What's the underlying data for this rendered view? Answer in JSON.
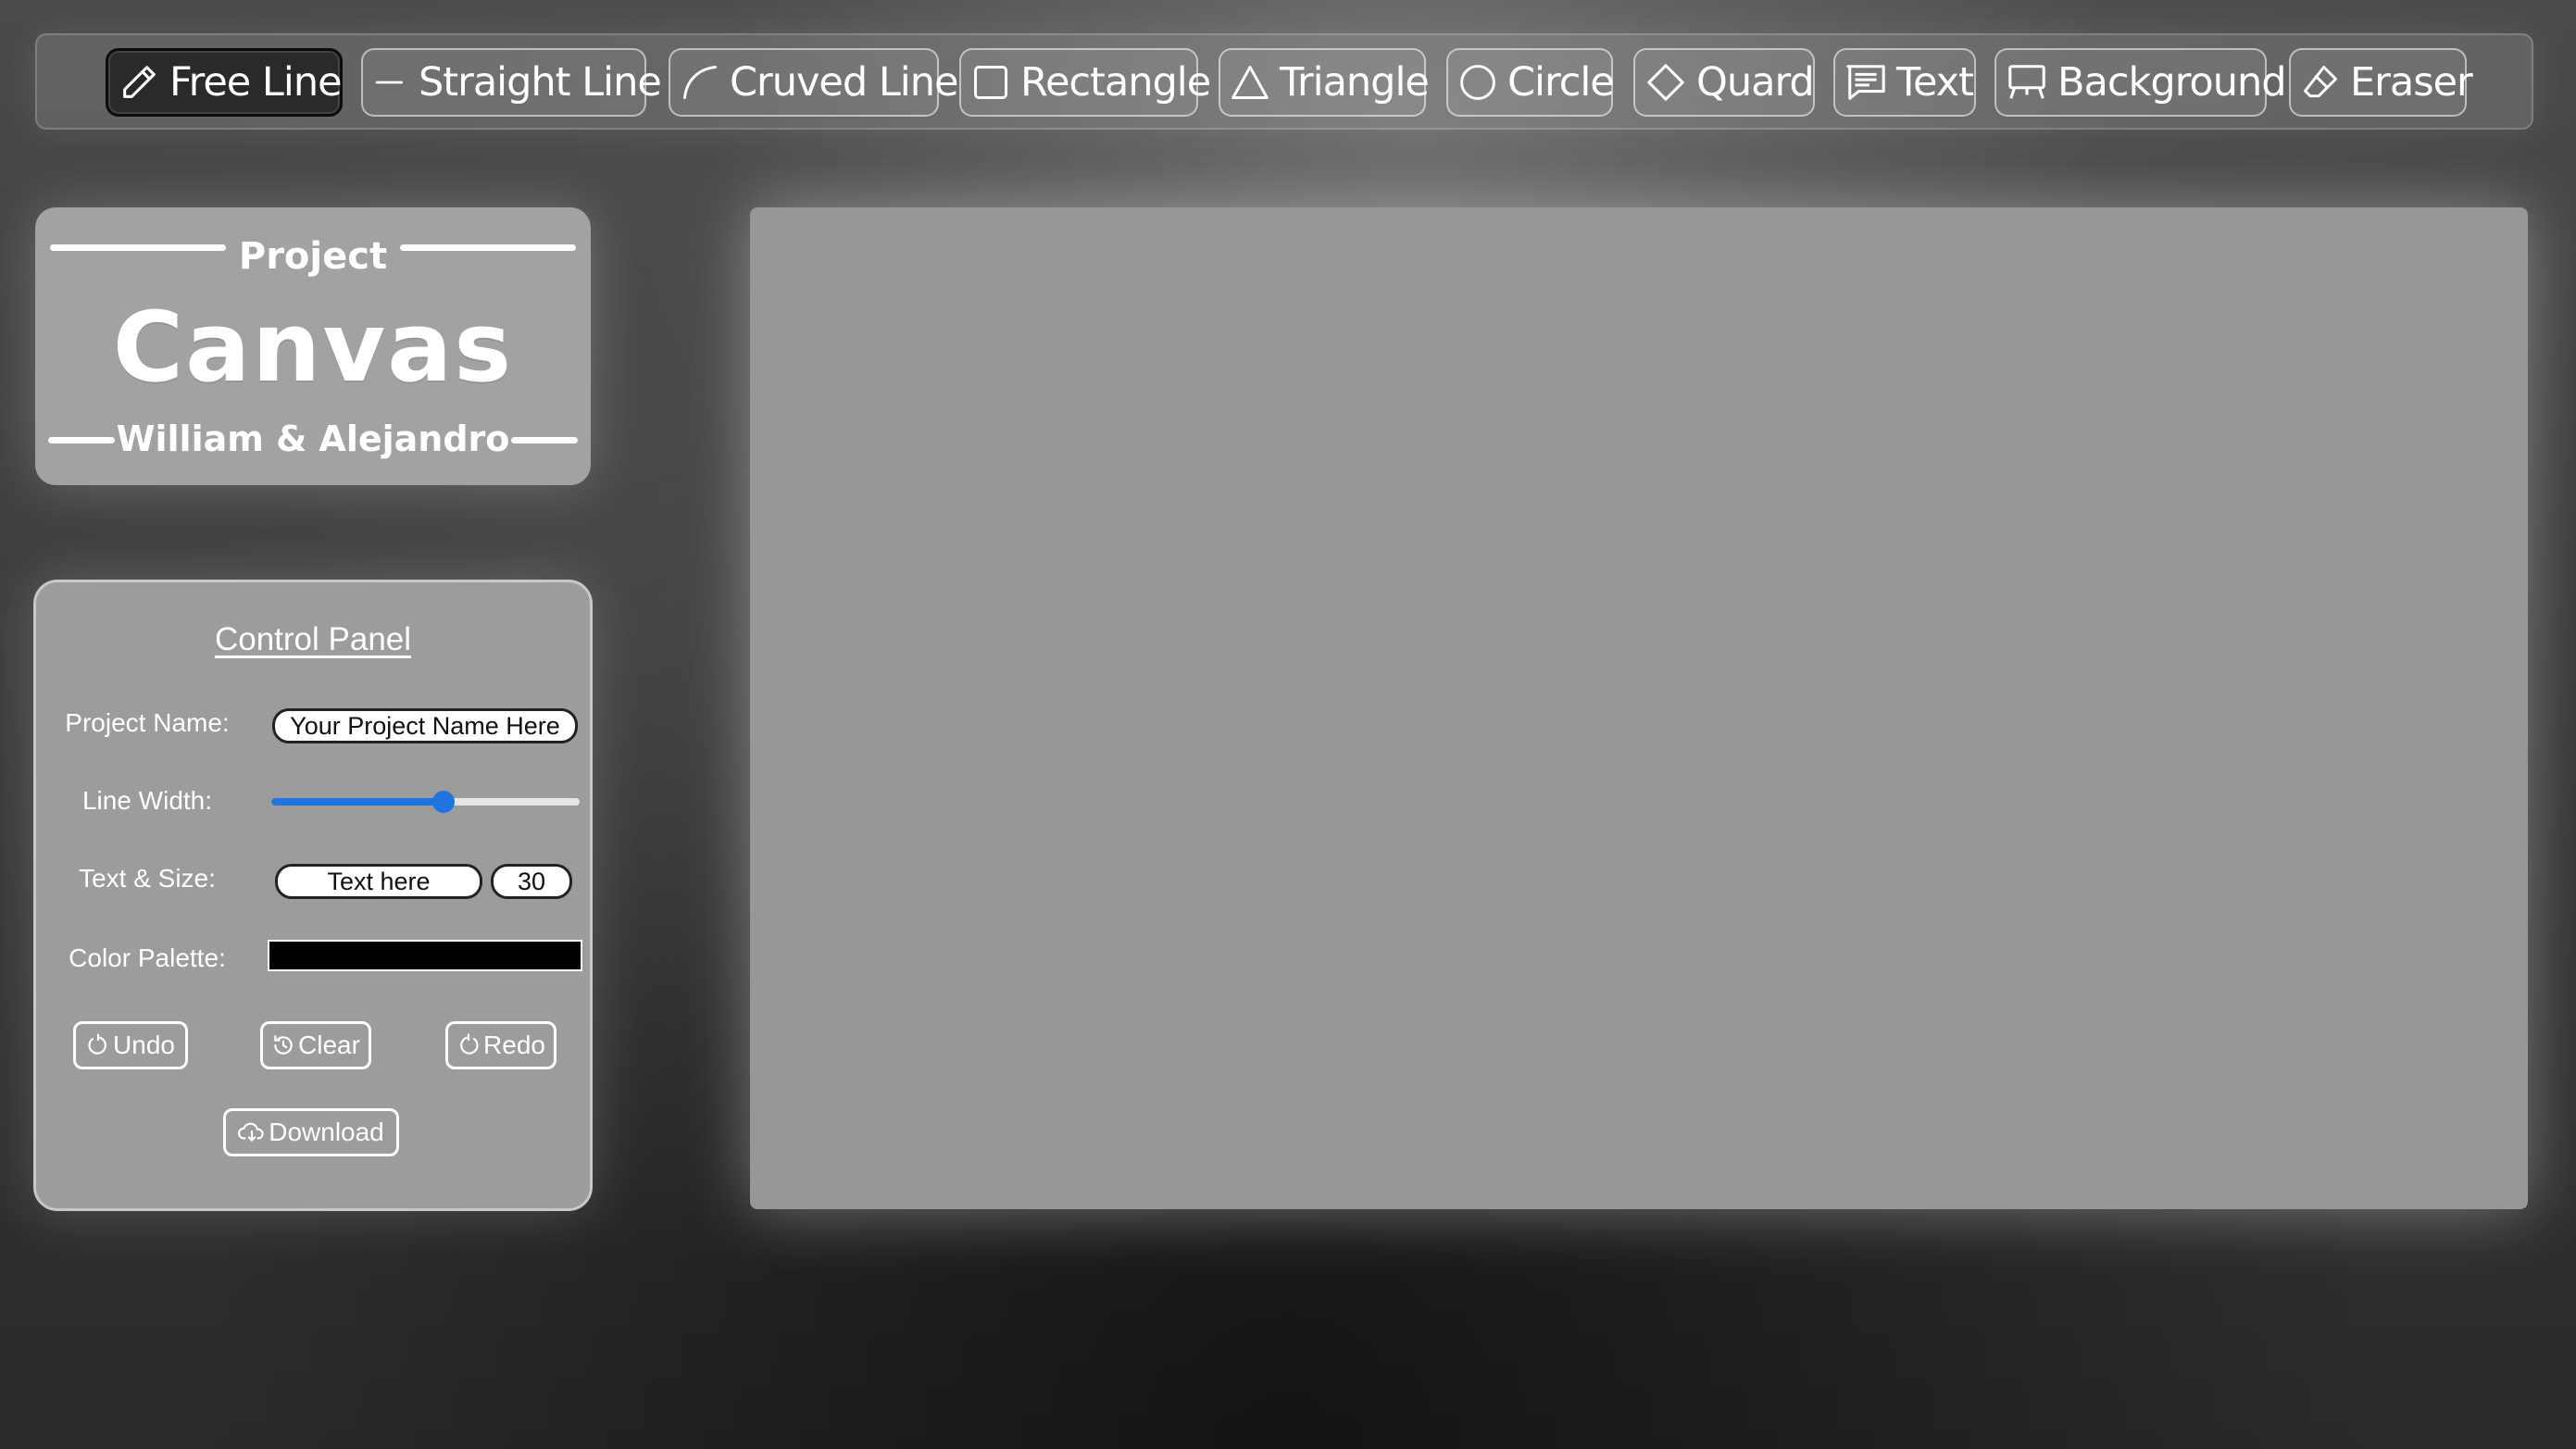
{
  "toolbar": {
    "tools": [
      {
        "label": "Free Line",
        "icon": "pencil-icon"
      },
      {
        "label": "Straight Line",
        "icon": "straight-line-icon"
      },
      {
        "label": "Cruved Line",
        "icon": "curve-icon"
      },
      {
        "label": "Rectangle",
        "icon": "square-icon"
      },
      {
        "label": "Triangle",
        "icon": "triangle-icon"
      },
      {
        "label": "Circle",
        "icon": "circle-icon"
      },
      {
        "label": "Quard",
        "icon": "diamond-icon"
      },
      {
        "label": "Text",
        "icon": "chat-text-icon"
      },
      {
        "label": "Background",
        "icon": "easel-icon"
      },
      {
        "label": "Eraser",
        "icon": "eraser-icon"
      }
    ],
    "active": "Free Line"
  },
  "title_card": {
    "top": "Project",
    "main": "Canvas",
    "bottom": "William & Alejandro"
  },
  "control_panel": {
    "title": "Control Panel",
    "project_name_label": "Project Name:",
    "project_name_value": "Your Project Name Here",
    "line_width_label": "Line Width:",
    "line_width_fraction": 0.56,
    "text_size_label": "Text & Size:",
    "text_value": "Text here",
    "size_value": "30",
    "color_label": "Color Palette:",
    "color_value": "#000000",
    "undo_label": "Undo",
    "clear_label": "Clear",
    "redo_label": "Redo",
    "download_label": "Download"
  },
  "colors": {
    "slider_accent": "#1f74e0",
    "canvas": "#979797",
    "panel": "#9c9c9c"
  }
}
